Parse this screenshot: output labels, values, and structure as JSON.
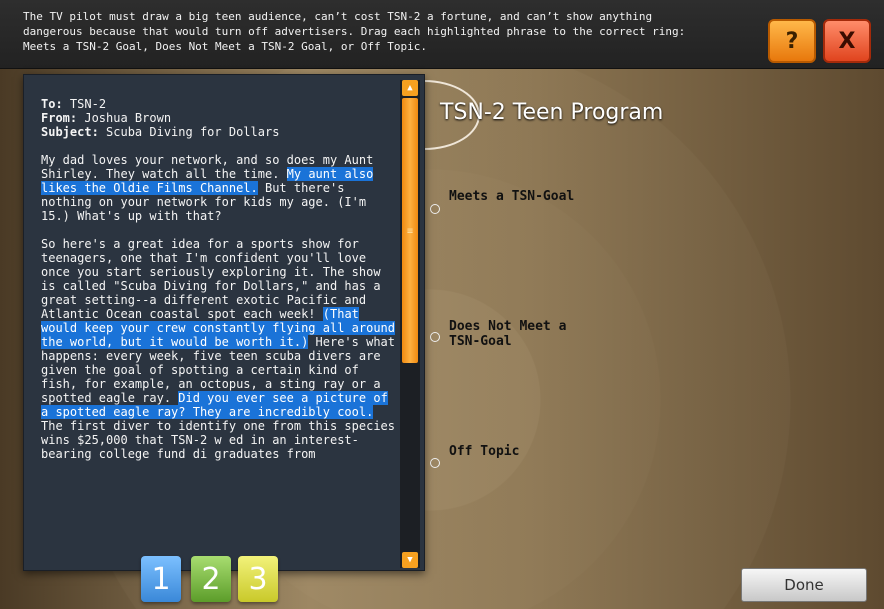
{
  "instructions": "The TV pilot must draw a big teen audience, can’t cost TSN-2 a fortune, and can’t show anything dangerous because that would turn off advertisers. Drag each highlighted phrase to the correct ring: Meets a TSN-2 Goal, Does Not Meet a TSN-2 Goal, or Off Topic.",
  "buttons": {
    "help": "?",
    "close": "X",
    "done": "Done"
  },
  "email": {
    "to_label": "To:",
    "to": "TSN-2",
    "from_label": "From:",
    "from": "Joshua Brown",
    "subject_label": "Subject:",
    "subject": "Scuba Diving for Dollars",
    "p1_a": "My dad loves your network, and so does my Aunt Shirley. They watch all the time. ",
    "p1_hl": "My aunt also likes the Oldie Films Channel.",
    "p1_b": " But there's nothing on your network for kids my age. (I'm 15.) What's up with that?",
    "p2_a": "So here's a great idea for a sports show for teenagers, one that I'm confident you'll love once you start seriously exploring it. The show is called \"Scuba Diving for Dollars,\" and has a great setting--a different exotic Pacific and Atlantic Ocean coastal spot each week! ",
    "p2_hl1": "(That would keep your crew constantly flying all around the world, but it would be worth it.)",
    "p2_b": " Here's what happens: every week, five teen scuba divers are given the goal of spotting a certain kind of fish, for example, an octopus, a sting ray or a spotted eagle ray. ",
    "p2_hl2": "Did you ever see a picture of a spotted eagle ray? They are incredibly cool.",
    "p2_c": " The first diver to identify one from this species wins $25,000 that TSN-2 w    ed in an interest-bearing college fund     di    graduates from"
  },
  "rings": {
    "title": "TSN-2 Teen Program",
    "meets": "Meets a TSN-Goal",
    "not_meets": "Does Not Meet a TSN-Goal",
    "off_topic": "Off Topic"
  },
  "tabs": [
    "1",
    "2",
    "3"
  ]
}
